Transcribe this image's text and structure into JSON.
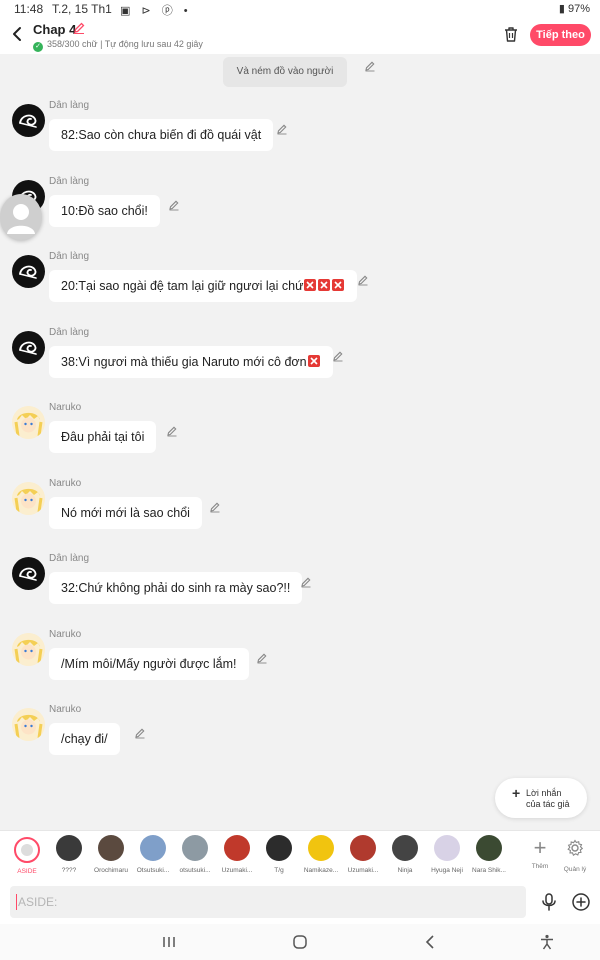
{
  "status_bar": {
    "time": "11:48",
    "date": "T.2, 15 Th1",
    "notification_icons": "▣ ⊳ ⓟ •",
    "battery": "97%"
  },
  "header": {
    "title": "Chap 4",
    "word_count": "358/300 chữ",
    "autosave": "Tự động lưu sau 42 giây",
    "next_label": "Tiếp theo"
  },
  "narration": {
    "text": "Và ném đồ vào người"
  },
  "messages": [
    {
      "speaker": "Dân làng",
      "text": "82:Sao còn chưa biến đi đồ quái vật"
    },
    {
      "speaker": "Dân làng",
      "text": "10:Đồ sao chổi!"
    },
    {
      "speaker": "Dân làng",
      "text": "20:Tại sao ngài đệ tam lại giữ ngươi lại chứ"
    },
    {
      "speaker": "Dân làng",
      "text": "38:Vì ngươi mà thiếu gia Naruto mới cô đơn"
    },
    {
      "speaker": "Naruko",
      "text": "Đâu phải tại tôi"
    },
    {
      "speaker": "Naruko",
      "text": "Nó mới mới là sao chổi"
    },
    {
      "speaker": "Dân làng",
      "text": "32:Chứ không phải do sinh ra mày sao?!!"
    },
    {
      "speaker": "Naruko",
      "text": "/Mím môi/Mấy người được lắm!"
    },
    {
      "speaker": "Naruko",
      "text": "/chạy đi/"
    }
  ],
  "note_button": {
    "line1": "Lời nhắn",
    "line2": "của tác giả"
  },
  "characters": {
    "aside_label": "ASIDE",
    "list": [
      {
        "name": "????",
        "color": "#3a3a3a"
      },
      {
        "name": "Orochimaru",
        "color": "#5b4a3f"
      },
      {
        "name": "Otsutsuki...",
        "color": "#7f9fc9"
      },
      {
        "name": "otsutsuki...",
        "color": "#8d9aa3"
      },
      {
        "name": "Uzumaki...",
        "color": "#c0392b"
      },
      {
        "name": "T/g",
        "color": "#2c2c2c"
      },
      {
        "name": "Namikaze...",
        "color": "#f1c40f"
      },
      {
        "name": "Uzumaki...",
        "color": "#b03a2e"
      },
      {
        "name": "Ninja",
        "color": "#444444"
      },
      {
        "name": "Hyuga Neji",
        "color": "#d8d2e6"
      },
      {
        "name": "Nara Shik...",
        "color": "#3b4a32"
      }
    ],
    "add_label": "Thêm",
    "manage_label": "Quản lý"
  },
  "input": {
    "placeholder": "ASIDE:"
  },
  "colors": {
    "accent": "#ff4a68",
    "background": "#f2f2f2",
    "bubble": "#ffffff"
  }
}
